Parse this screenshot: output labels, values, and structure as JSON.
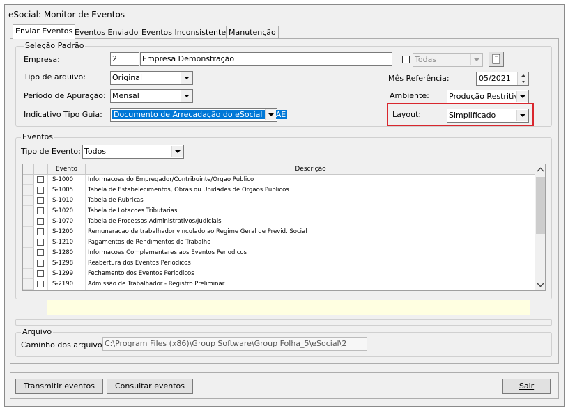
{
  "window": {
    "title": "eSocial: Monitor de Eventos"
  },
  "tabs": [
    {
      "label": "Enviar Eventos",
      "active": true
    },
    {
      "label": "Eventos Enviados"
    },
    {
      "label": "Eventos Inconsistentes"
    },
    {
      "label": "Manutenção"
    }
  ],
  "selecao": {
    "legend": "Seleção Padrão",
    "empresa_label": "Empresa:",
    "empresa_code": "2",
    "empresa_name": "Empresa Demonstração",
    "todas_label": "Todas",
    "tipo_arquivo_label": "Tipo de arquivo:",
    "tipo_arquivo_value": "Original",
    "periodo_label": "Período de Apuração:",
    "periodo_value": "Mensal",
    "indicativo_label": "Indicativo Tipo Guia:",
    "indicativo_value": "Documento de Arrecadação do eSocial - DAE",
    "mes_label": "Mês Referência:",
    "mes_value": "05/2021",
    "ambiente_label": "Ambiente:",
    "ambiente_value": "Produção Restritiva",
    "layout_label": "Layout:",
    "layout_value": "Simplificado",
    "highlight_color": "#d9272e"
  },
  "eventos": {
    "legend": "Eventos",
    "tipo_label": "Tipo de Evento:",
    "tipo_value": "Todos",
    "columns": {
      "evento": "Evento",
      "descricao": "Descrição"
    },
    "rows": [
      {
        "code": "S-1000",
        "desc": "Informacoes do Empregador/Contribuinte/Orgao Publico"
      },
      {
        "code": "S-1005",
        "desc": "Tabela de Estabelecimentos, Obras ou Unidades de Orgaos Publicos"
      },
      {
        "code": "S-1010",
        "desc": "Tabela de Rubricas"
      },
      {
        "code": "S-1020",
        "desc": "Tabela de Lotacoes Tributarias"
      },
      {
        "code": "S-1070",
        "desc": "Tabela de Processos Administrativos/Judiciais"
      },
      {
        "code": "S-1200",
        "desc": "Remuneracao de trabalhador vinculado ao Regime Geral de Previd. Social"
      },
      {
        "code": "S-1210",
        "desc": "Pagamentos de Rendimentos do Trabalho"
      },
      {
        "code": "S-1280",
        "desc": "Informacoes Complementares aos Eventos Periodicos"
      },
      {
        "code": "S-1298",
        "desc": "Reabertura dos Eventos Periodicos"
      },
      {
        "code": "S-1299",
        "desc": "Fechamento dos Eventos Periodicos"
      },
      {
        "code": "S-2190",
        "desc": "Admissão de Trabalhador - Registro Preliminar"
      }
    ]
  },
  "arquivo": {
    "legend": "Arquivo",
    "caminho_label": "Caminho dos arquivos:",
    "caminho_value": "C:\\Program Files (x86)\\Group Software\\Group Folha_5\\eSocial\\2"
  },
  "buttons": {
    "transmitir": "Transmitir eventos",
    "consultar": "Consultar eventos",
    "sair": "Sair"
  },
  "icons": {
    "browse": "book-icon",
    "scroll_up": "chevron-up-icon",
    "scroll_down": "chevron-down-icon"
  },
  "colors": {
    "info_bar": "#ffffe1",
    "selection": "#0078d7"
  }
}
